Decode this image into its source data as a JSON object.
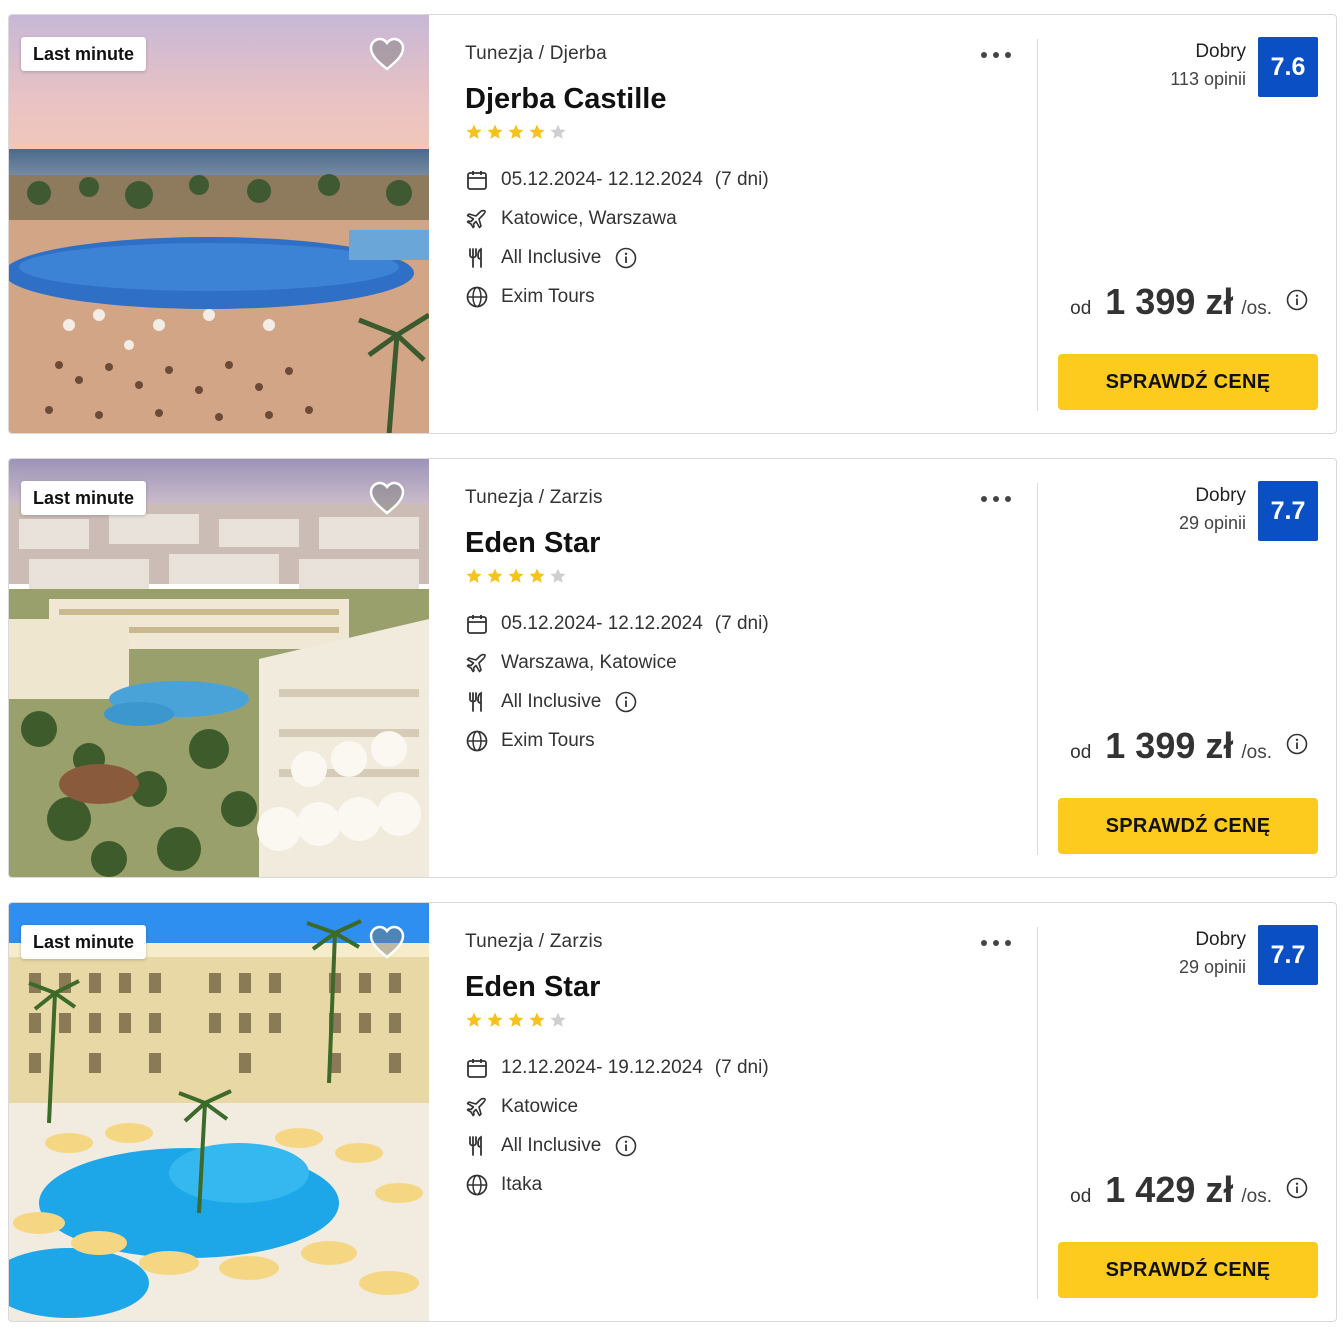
{
  "offers": [
    {
      "badge": "Last minute",
      "country": "Tunezja",
      "sep": "/",
      "region": "Djerba",
      "name": "Djerba Castille",
      "stars": 4,
      "dates": "05.12.2024- 12.12.2024",
      "duration": "(7 dni)",
      "departure": "Katowice, Warszawa",
      "board": "All Inclusive",
      "operator": "Exim Tours",
      "rating_word": "Dobry",
      "rating_count": "113 opinii",
      "score": "7.6",
      "price_prefix": "od",
      "price": "1 399 zł",
      "price_suffix": "/os.",
      "cta": "SPRAWDŹ CENĘ",
      "photo_theme": "sunset-resort"
    },
    {
      "badge": "Last minute",
      "country": "Tunezja",
      "sep": "/",
      "region": "Zarzis",
      "name": "Eden Star",
      "stars": 4,
      "dates": "05.12.2024- 12.12.2024",
      "duration": "(7 dni)",
      "departure": "Warszawa, Katowice",
      "board": "All Inclusive",
      "operator": "Exim Tours",
      "rating_word": "Dobry",
      "rating_count": "29 opinii",
      "score": "7.7",
      "price_prefix": "od",
      "price": "1 399 zł",
      "price_suffix": "/os.",
      "cta": "SPRAWDŹ CENĘ",
      "photo_theme": "aerial-resort"
    },
    {
      "badge": "Last minute",
      "country": "Tunezja",
      "sep": "/",
      "region": "Zarzis",
      "name": "Eden Star",
      "stars": 4,
      "dates": "12.12.2024- 19.12.2024",
      "duration": "(7 dni)",
      "departure": "Katowice",
      "board": "All Inclusive",
      "operator": "Itaka",
      "rating_word": "Dobry",
      "rating_count": "29 opinii",
      "score": "7.7",
      "price_prefix": "od",
      "price": "1 429 zł",
      "price_suffix": "/os.",
      "cta": "SPRAWDŹ CENĘ",
      "photo_theme": "pool-hotel"
    }
  ],
  "colors": {
    "cta": "#fdcb1d",
    "score": "#0a4fc4",
    "star_on": "#f6c21c",
    "star_off": "#cfcfcf"
  },
  "icons": {
    "favorite": "heart-icon",
    "more": "more-dots-icon",
    "dates": "calendar-icon",
    "departure": "plane-icon",
    "board": "cutlery-icon",
    "operator": "globe-icon",
    "info": "info-icon",
    "star": "star-icon"
  }
}
